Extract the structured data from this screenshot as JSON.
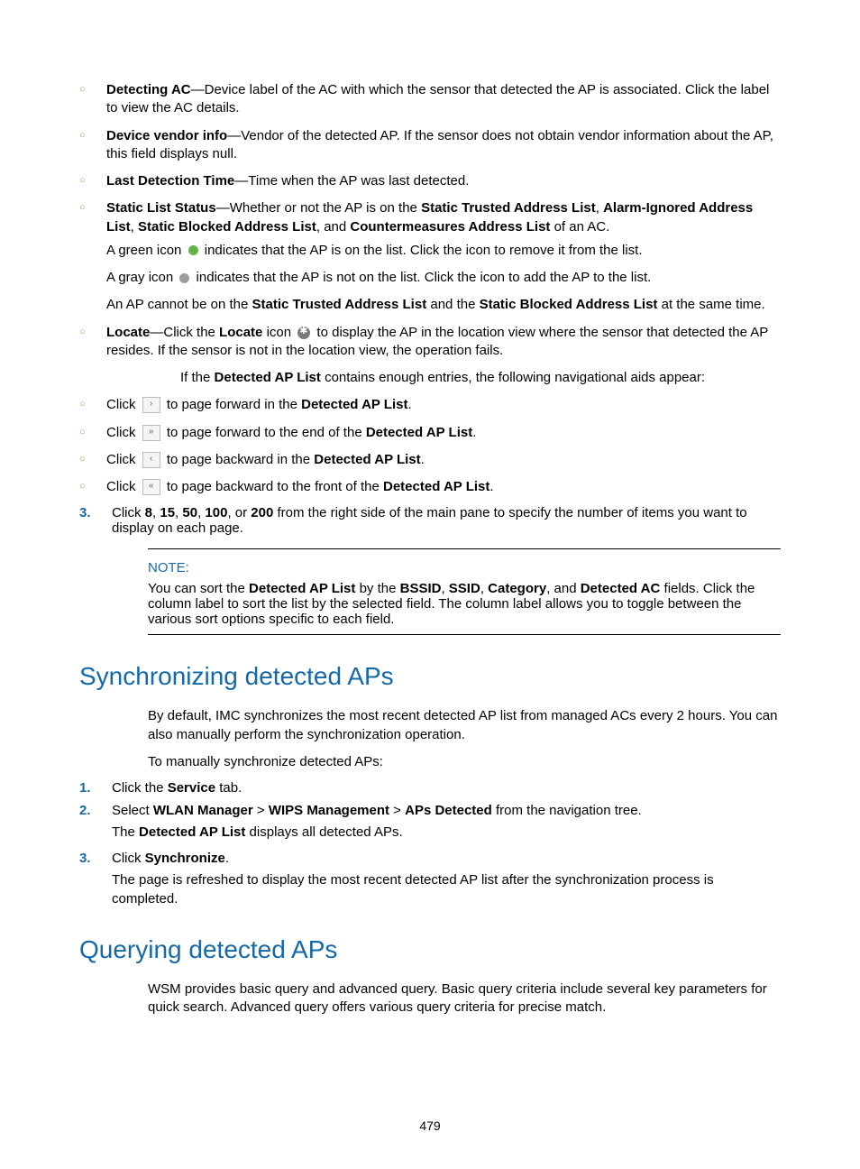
{
  "bullets_top": {
    "detecting_ac_term": "Detecting AC",
    "detecting_ac_text1": "—Device label of the AC with which the sensor that detected the AP is associated. Click the label to view the AC details.",
    "vendor_term": "Device vendor info",
    "vendor_text": "—Vendor of the detected AP. If the sensor does not obtain vendor information about the AP, this field displays null.",
    "last_det_term": "Last Detection Time",
    "last_det_text": "—Time when the AP was last detected.",
    "static_term": "Static List Status",
    "static_text_a": "—Whether or not the AP is on the ",
    "static_b1": "Static Trusted Address List",
    "static_b2": "Alarm-Ignored Address List",
    "static_b3": "Static Blocked Address List",
    "static_b4": "Countermeasures Address List",
    "static_text_b": " of an AC.",
    "green_a": "A green icon ",
    "green_b": " indicates that the AP is on the list. Click the icon to remove it from the list.",
    "gray_a": "A gray icon ",
    "gray_b": " indicates that the AP is not on the list. Click the icon to add the AP to the list.",
    "cannot_a": "An AP cannot be on the ",
    "cannot_b": " and the ",
    "cannot_c": " at the same time.",
    "locate_term": "Locate",
    "locate_a": "—Click the ",
    "locate_b": " icon ",
    "locate_c": " to display the AP in the location view where the sensor that detected the AP resides. If the sensor is not in the location view, the operation fails."
  },
  "nav_intro_a": "If the ",
  "nav_intro_bold": "Detected AP List",
  "nav_intro_b": " contains enough entries, the following navigational aids appear:",
  "nav_items": {
    "click": "Click ",
    "fwd": " to page forward in the ",
    "fwd_end": " to page forward to the end of the ",
    "back": " to page backward in the ",
    "back_front": " to page backward to the front of the ",
    "dap": "Detected AP List"
  },
  "step3_a": "Click ",
  "step3_nums": [
    "8",
    "15",
    "50",
    "100",
    "200"
  ],
  "step3_b": " from the right side of the main pane to specify the number of items you want to display on each page.",
  "note_label": "NOTE:",
  "note_a": "You can sort the ",
  "note_fields": [
    "BSSID",
    "SSID",
    "Category",
    "Detected AC"
  ],
  "note_b": " fields. Click the column label to sort the list by the selected field. The column label allows you to toggle between the various sort options specific to each field.",
  "note_by_the": " by the ",
  "h1": "Synchronizing detected APs",
  "sync_p1": "By default, IMC synchronizes the most recent detected AP list from managed ACs every 2 hours. You can also manually perform the synchronization operation.",
  "sync_p2": "To manually synchronize detected APs:",
  "sync_steps": {
    "s1_a": "Click the ",
    "s1_b": "Service",
    "s1_c": " tab.",
    "s2_a": "Select ",
    "s2_nav": [
      "WLAN Manager",
      "WIPS Management",
      "APs Detected"
    ],
    "s2_b": " from the navigation tree.",
    "s2_c_a": "The ",
    "s2_c_b": "Detected AP List",
    "s2_c_c": " displays all detected APs.",
    "s3_a": "Click ",
    "s3_b": "Synchronize",
    "s3_p": "The page is refreshed to display the most recent detected AP list after the synchronization process is completed."
  },
  "h2": "Querying detected APs",
  "query_p": "WSM provides basic query and advanced query. Basic query criteria include several key parameters for quick search. Advanced query offers various query criteria for precise match.",
  "page_num": "479",
  "comma": ", ",
  "and": ", and ",
  "or": ", or ",
  "period": "."
}
